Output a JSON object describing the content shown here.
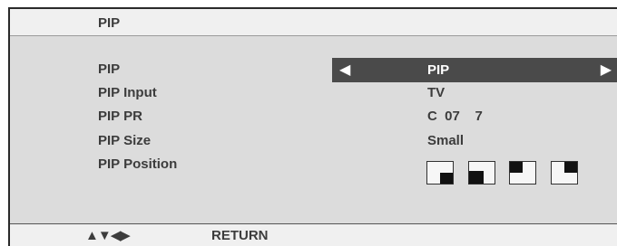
{
  "menu": {
    "title": "PIP",
    "items": [
      {
        "label": "PIP",
        "value": "PIP"
      },
      {
        "label": "PIP Input",
        "value": "TV"
      },
      {
        "label": "PIP PR",
        "value": "C  07    7"
      },
      {
        "label": "PIP Size",
        "value": "Small"
      },
      {
        "label": "PIP Position"
      }
    ]
  },
  "icons": {
    "left_arrow": "◀",
    "right_arrow": "▶",
    "position_options": [
      "bottom-right",
      "bottom-right-large",
      "top-left",
      "top-right"
    ]
  },
  "footer": {
    "nav_arrows": "▲▼◀▶",
    "return_label": "RETURN"
  },
  "colors": {
    "panel": "#dcdcdc",
    "bar": "#f0f0f0",
    "selection": "#4a4a4a",
    "text": "#3c3c3c"
  }
}
